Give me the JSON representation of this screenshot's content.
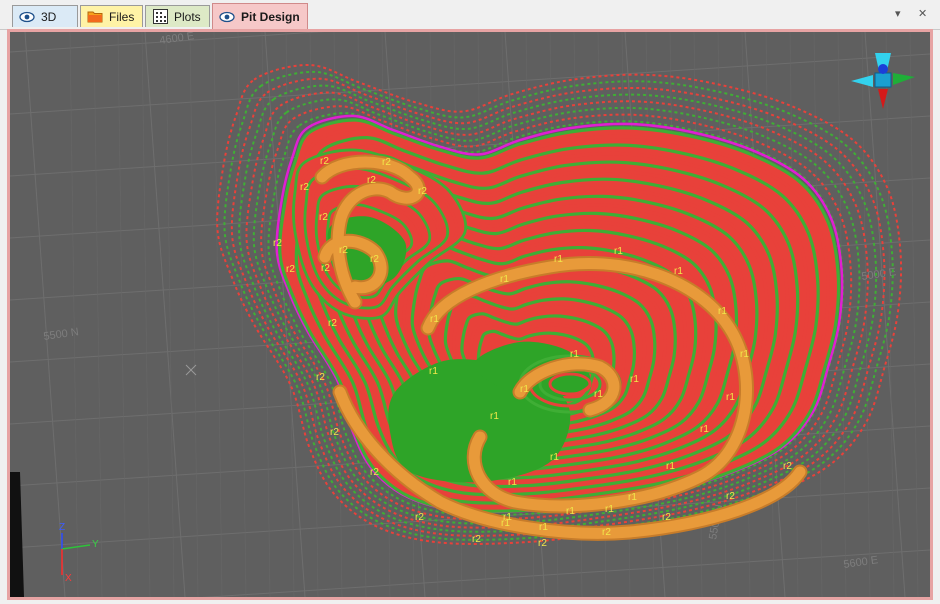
{
  "tabs": [
    {
      "label": "3D",
      "icon": "eye-icon"
    },
    {
      "label": "Files",
      "icon": "folder-icon"
    },
    {
      "label": "Plots",
      "icon": "grid-chart-icon"
    },
    {
      "label": "Pit Design",
      "icon": "eye-icon",
      "active": true
    }
  ],
  "window_controls": {
    "dropdown": "▾",
    "close": "✕"
  },
  "colors": {
    "viewport_bg": "#5f5f5f",
    "bench_red": "#e8413a",
    "bench_green": "#3fae35",
    "ramp_orange": "#e89a3a",
    "crest_magenta": "#e01fd2",
    "pit_floor_green": "#2ea428",
    "border_pink": "#e7a3a3"
  },
  "grid_labels": {
    "top_easting": "4600 E",
    "left_northing": "5500 N",
    "right_easting": "5000 E",
    "bottom_northing": "5500 N",
    "bottom_right": "5600 E"
  },
  "ramp_labels": [
    "r1",
    "r2"
  ],
  "axes": {
    "z": "Z",
    "y": "Y",
    "x": "X"
  }
}
